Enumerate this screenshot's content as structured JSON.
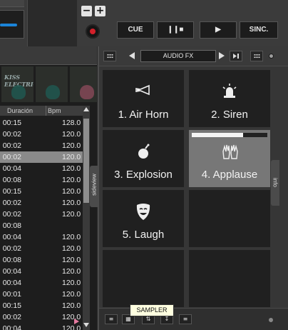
{
  "deck": {
    "minus_label": "−",
    "plus_label": "+",
    "cue_label": "CUE",
    "pause_play_label": "❙❙■",
    "play_label": "▶",
    "sync_label": "SINC."
  },
  "library": {
    "album_art_text": "KISS ELECTRIC",
    "columns": {
      "duration": "Duración",
      "bpm": "Bpm"
    },
    "rows": [
      {
        "duration": "00:15",
        "bpm": "128.0",
        "selected": false
      },
      {
        "duration": "00:02",
        "bpm": "120.0",
        "selected": false
      },
      {
        "duration": "00:02",
        "bpm": "120.0",
        "selected": false
      },
      {
        "duration": "00:02",
        "bpm": "120.0",
        "selected": true
      },
      {
        "duration": "00:04",
        "bpm": "120.0",
        "selected": false
      },
      {
        "duration": "00:08",
        "bpm": "120.0",
        "selected": false
      },
      {
        "duration": "00:15",
        "bpm": "120.0",
        "selected": false
      },
      {
        "duration": "00:02",
        "bpm": "120.0",
        "selected": false
      },
      {
        "duration": "00:02",
        "bpm": "120.0",
        "selected": false
      },
      {
        "duration": "00:08",
        "bpm": "",
        "selected": false
      },
      {
        "duration": "00:04",
        "bpm": "120.0",
        "selected": false
      },
      {
        "duration": "00:02",
        "bpm": "120.0",
        "selected": false
      },
      {
        "duration": "00:08",
        "bpm": "120.0",
        "selected": false
      },
      {
        "duration": "00:04",
        "bpm": "120.0",
        "selected": false
      },
      {
        "duration": "00:04",
        "bpm": "120.0",
        "selected": false
      },
      {
        "duration": "00:01",
        "bpm": "120.0",
        "selected": false
      },
      {
        "duration": "00:15",
        "bpm": "120.0",
        "selected": false
      },
      {
        "duration": "00:02",
        "bpm": "120.0",
        "selected": false
      },
      {
        "duration": "00:04",
        "bpm": "120.0",
        "selected": false
      }
    ],
    "sideview_label": "sideview"
  },
  "fx": {
    "title": "AUDIO FX",
    "pads": [
      {
        "label": "1. Air Horn",
        "icon": "air-horn-icon",
        "active": false
      },
      {
        "label": "2. Siren",
        "icon": "siren-icon",
        "active": false
      },
      {
        "label": "3. Explosion",
        "icon": "bomb-icon",
        "active": false
      },
      {
        "label": "4. Applause",
        "icon": "applause-icon",
        "active": true,
        "progress": 0.68
      },
      {
        "label": "5. Laugh",
        "icon": "laugh-mask-icon",
        "active": false
      },
      {
        "label": "",
        "icon": "",
        "active": false
      },
      {
        "label": "",
        "icon": "",
        "active": false
      },
      {
        "label": "",
        "icon": "",
        "active": false
      }
    ],
    "info_label": "info",
    "tooltip": "SAMPLER"
  },
  "colors": {
    "accent_blue": "#1b84d8",
    "record_red": "#d3202a",
    "pad_active": "#777777",
    "pad_idle": "#202020"
  }
}
